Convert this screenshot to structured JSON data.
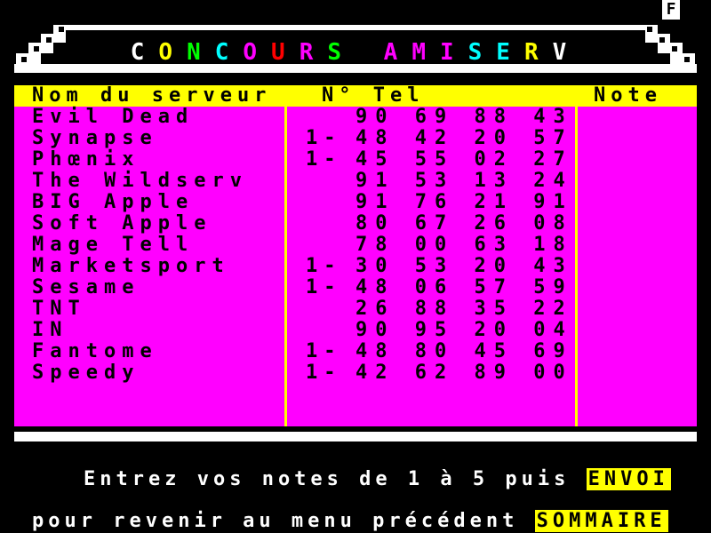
{
  "status": {
    "indicator": "F"
  },
  "title": {
    "letters": [
      {
        "ch": "C",
        "color": "#ffffff"
      },
      {
        "ch": "O",
        "color": "#ffff00"
      },
      {
        "ch": "N",
        "color": "#00ff00"
      },
      {
        "ch": "C",
        "color": "#00ffff"
      },
      {
        "ch": "O",
        "color": "#ff00ff"
      },
      {
        "ch": "U",
        "color": "#ff0000"
      },
      {
        "ch": "R",
        "color": "#ff00ff"
      },
      {
        "ch": "S",
        "color": "#00ff00"
      },
      {
        "ch": " ",
        "color": "#000000"
      },
      {
        "ch": "A",
        "color": "#ff00ff"
      },
      {
        "ch": "M",
        "color": "#ff00ff"
      },
      {
        "ch": "I",
        "color": "#ff00ff"
      },
      {
        "ch": "S",
        "color": "#00ffff"
      },
      {
        "ch": "E",
        "color": "#00ffff"
      },
      {
        "ch": "R",
        "color": "#ffff00"
      },
      {
        "ch": "V",
        "color": "#ffffff"
      }
    ]
  },
  "table": {
    "headers": {
      "name": "Nom du serveur",
      "tel": "N° Tel",
      "note": "Note"
    },
    "rows": [
      {
        "name": "Evil Dead",
        "prefix": "",
        "tel": "90 69 88 43"
      },
      {
        "name": "Synapse",
        "prefix": "1-",
        "tel": "48 42 20 57"
      },
      {
        "name": "Phœnix",
        "prefix": "1-",
        "tel": "45 55 02 27"
      },
      {
        "name": "The Wildserv",
        "prefix": "",
        "tel": "91 53 13 24"
      },
      {
        "name": "BIG Apple",
        "prefix": "",
        "tel": "91 76 21 91"
      },
      {
        "name": "Soft Apple",
        "prefix": "",
        "tel": "80 67 26 08"
      },
      {
        "name": "Mage Tell",
        "prefix": "",
        "tel": "78 00 63 18"
      },
      {
        "name": "Marketsport",
        "prefix": "1-",
        "tel": "30 53 20 43"
      },
      {
        "name": "Sesame",
        "prefix": "1-",
        "tel": "48 06 57 59"
      },
      {
        "name": "TNT",
        "prefix": "",
        "tel": "26 88 35 22"
      },
      {
        "name": "IN",
        "prefix": "",
        "tel": "90 95 20 04"
      },
      {
        "name": "Fantome",
        "prefix": "1-",
        "tel": "48 80 45 69"
      },
      {
        "name": "Speedy",
        "prefix": "1-",
        "tel": "42 62 89 00"
      }
    ]
  },
  "footer": {
    "line1_text": "Entrez vos notes de 1 à 5 puis",
    "line1_key": "ENVOI",
    "line2_text": "pour revenir au menu précédent",
    "line2_key": "SOMMAIRE"
  },
  "colors": {
    "background": "#000000",
    "header_bar": "#ffff00",
    "table_bg": "#ff00ff",
    "key_bg": "#ffff00",
    "text_light": "#ffffff"
  }
}
